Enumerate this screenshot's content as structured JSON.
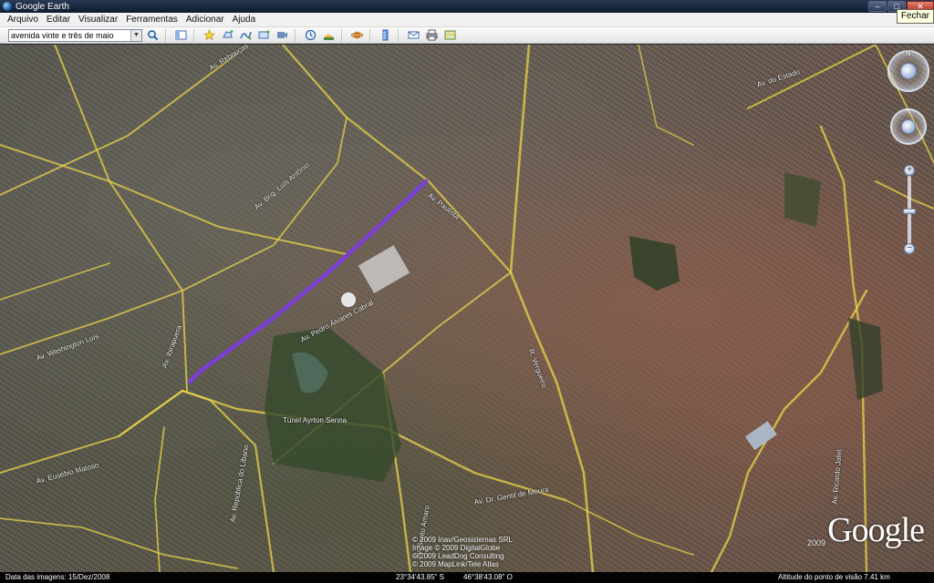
{
  "window": {
    "title": "Google Earth",
    "buttons": {
      "minimize": "–",
      "maximize": "□",
      "close": "✕"
    },
    "tooltip": "Fechar"
  },
  "menu": {
    "items": [
      "Arquivo",
      "Editar",
      "Visualizar",
      "Ferramentas",
      "Adicionar",
      "Ajuda"
    ]
  },
  "search": {
    "value": "avenida vinte e três de maio"
  },
  "toolbar": {
    "icons": [
      "sidebar-toggle-icon",
      "placemark-icon",
      "polygon-icon",
      "path-icon",
      "image-overlay-icon",
      "record-tour-icon",
      "historical-imagery-icon",
      "sunlight-icon",
      "planets-icon",
      "ruler-icon",
      "email-icon",
      "print-icon",
      "google-maps-icon"
    ]
  },
  "map": {
    "road_labels": [
      "Av. Rebouças",
      "Av. Paulista",
      "Av. Brig. Luís Antônio",
      "Av. Pedro Álvares Cabral",
      "Túnel Ayrton Senna",
      "Av. República do Líbano",
      "Av. Ibirapuera",
      "Av. Washington Luís",
      "R. Vergueiro",
      "Av. Ricardo Jafet",
      "Av. Dr. Gentil de Moura",
      "Av. Santo Amaro",
      "Av. Eusébio Matoso",
      "Av. do Estado"
    ],
    "copyright": [
      "© 2009 Inav/Geosistemas SRL",
      "Image © 2009 DigitalGlobe",
      "© 2009 LeadDog Consulting",
      "© 2009 MapLink/Tele Atlas"
    ],
    "logo": "Google",
    "logo_year": "2009",
    "highlight_color": "#7b3fd6",
    "road_color": "#e8d44a"
  },
  "status": {
    "imagery_date": "Data das imagens: 15/Dez/2008",
    "latitude": "23°34'43.85\" S",
    "longitude": "46°38'43.08\" O",
    "eye_altitude": "Altitude do ponto de visão   7.41 km"
  }
}
